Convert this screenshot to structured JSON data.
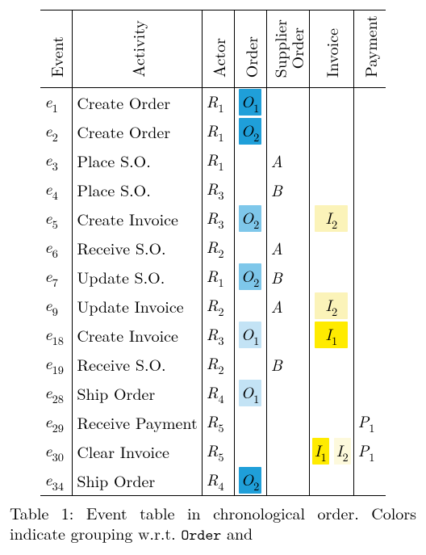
{
  "headers": {
    "event": "Event",
    "activity": "Activity",
    "actor": "Actor",
    "order": "Order",
    "supplier_order_l1": "Supplier",
    "supplier_order_l2": "Order",
    "invoice": "Invoice",
    "payment": "Payment"
  },
  "rows": [
    {
      "event_sym": "e",
      "event_sub": "1",
      "activity": "Create Order",
      "actor_sym": "R",
      "actor_sub": "1",
      "order": {
        "label_sym": "O",
        "label_sub": "1",
        "shade": "o-dark"
      },
      "supplier": "",
      "invoice": [],
      "payment": ""
    },
    {
      "event_sym": "e",
      "event_sub": "2",
      "activity": "Create Order",
      "actor_sym": "R",
      "actor_sub": "1",
      "order": {
        "label_sym": "O",
        "label_sub": "2",
        "shade": "o-dark"
      },
      "supplier": "",
      "invoice": [],
      "payment": ""
    },
    {
      "event_sym": "e",
      "event_sub": "3",
      "activity": "Place S.O.",
      "actor_sym": "R",
      "actor_sub": "1",
      "order": null,
      "supplier": "A",
      "invoice": [],
      "payment": ""
    },
    {
      "event_sym": "e",
      "event_sub": "4",
      "activity": "Place S.O.",
      "actor_sym": "R",
      "actor_sub": "3",
      "order": null,
      "supplier": "B",
      "invoice": [],
      "payment": ""
    },
    {
      "event_sym": "e",
      "event_sub": "5",
      "activity": "Create Invoice",
      "actor_sym": "R",
      "actor_sub": "3",
      "order": {
        "label_sym": "O",
        "label_sub": "2",
        "shade": "o-mid"
      },
      "supplier": "",
      "invoice": [
        {
          "label_sym": "I",
          "label_sub": "2",
          "shade": "i-light"
        }
      ],
      "payment": ""
    },
    {
      "event_sym": "e",
      "event_sub": "6",
      "activity": "Receive S.O.",
      "actor_sym": "R",
      "actor_sub": "2",
      "order": null,
      "supplier": "A",
      "invoice": [],
      "payment": ""
    },
    {
      "event_sym": "e",
      "event_sub": "7",
      "activity": "Update S.O.",
      "actor_sym": "R",
      "actor_sub": "1",
      "order": {
        "label_sym": "O",
        "label_sub": "2",
        "shade": "o-mid"
      },
      "supplier": "B",
      "invoice": [],
      "payment": ""
    },
    {
      "event_sym": "e",
      "event_sub": "9",
      "activity": "Update Invoice",
      "actor_sym": "R",
      "actor_sub": "2",
      "order": null,
      "supplier": "A",
      "invoice": [
        {
          "label_sym": "I",
          "label_sub": "2",
          "shade": "i-light"
        }
      ],
      "payment": ""
    },
    {
      "event_sym": "e",
      "event_sub": "18",
      "activity": "Create Invoice",
      "actor_sym": "R",
      "actor_sub": "3",
      "order": {
        "label_sym": "O",
        "label_sub": "1",
        "shade": "o-light"
      },
      "supplier": "",
      "invoice": [
        {
          "label_sym": "I",
          "label_sub": "1",
          "shade": "i-dark"
        }
      ],
      "payment": ""
    },
    {
      "event_sym": "e",
      "event_sub": "19",
      "activity": "Receive S.O.",
      "actor_sym": "R",
      "actor_sub": "2",
      "order": null,
      "supplier": "B",
      "invoice": [],
      "payment": ""
    },
    {
      "event_sym": "e",
      "event_sub": "28",
      "activity": "Ship Order",
      "actor_sym": "R",
      "actor_sub": "4",
      "order": {
        "label_sym": "O",
        "label_sub": "1",
        "shade": "o-light"
      },
      "supplier": "",
      "invoice": [],
      "payment": ""
    },
    {
      "event_sym": "e",
      "event_sub": "29",
      "activity": "Receive Payment",
      "actor_sym": "R",
      "actor_sub": "5",
      "order": null,
      "supplier": "",
      "invoice": [],
      "payment_sym": "P",
      "payment_sub": "1"
    },
    {
      "event_sym": "e",
      "event_sub": "30",
      "activity": "Clear Invoice",
      "actor_sym": "R",
      "actor_sub": "5",
      "order": null,
      "supplier": "",
      "invoice": [
        {
          "label_sym": "I",
          "label_sub": "1",
          "shade": "i-dark"
        },
        {
          "label_sym": "I",
          "label_sub": "2",
          "shade": "i-vlight"
        }
      ],
      "payment_sym": "P",
      "payment_sub": "1"
    },
    {
      "event_sym": "e",
      "event_sub": "34",
      "activity": "Ship Order",
      "actor_sym": "R",
      "actor_sub": "4",
      "order": {
        "label_sym": "O",
        "label_sub": "2",
        "shade": "o-dark"
      },
      "supplier": "",
      "invoice": [],
      "payment": ""
    }
  ],
  "caption": {
    "prefix": "Table 1: Event table in chronological order. Colors indicate grouping w.r.t. ",
    "code": "Order",
    "suffix": " and"
  }
}
